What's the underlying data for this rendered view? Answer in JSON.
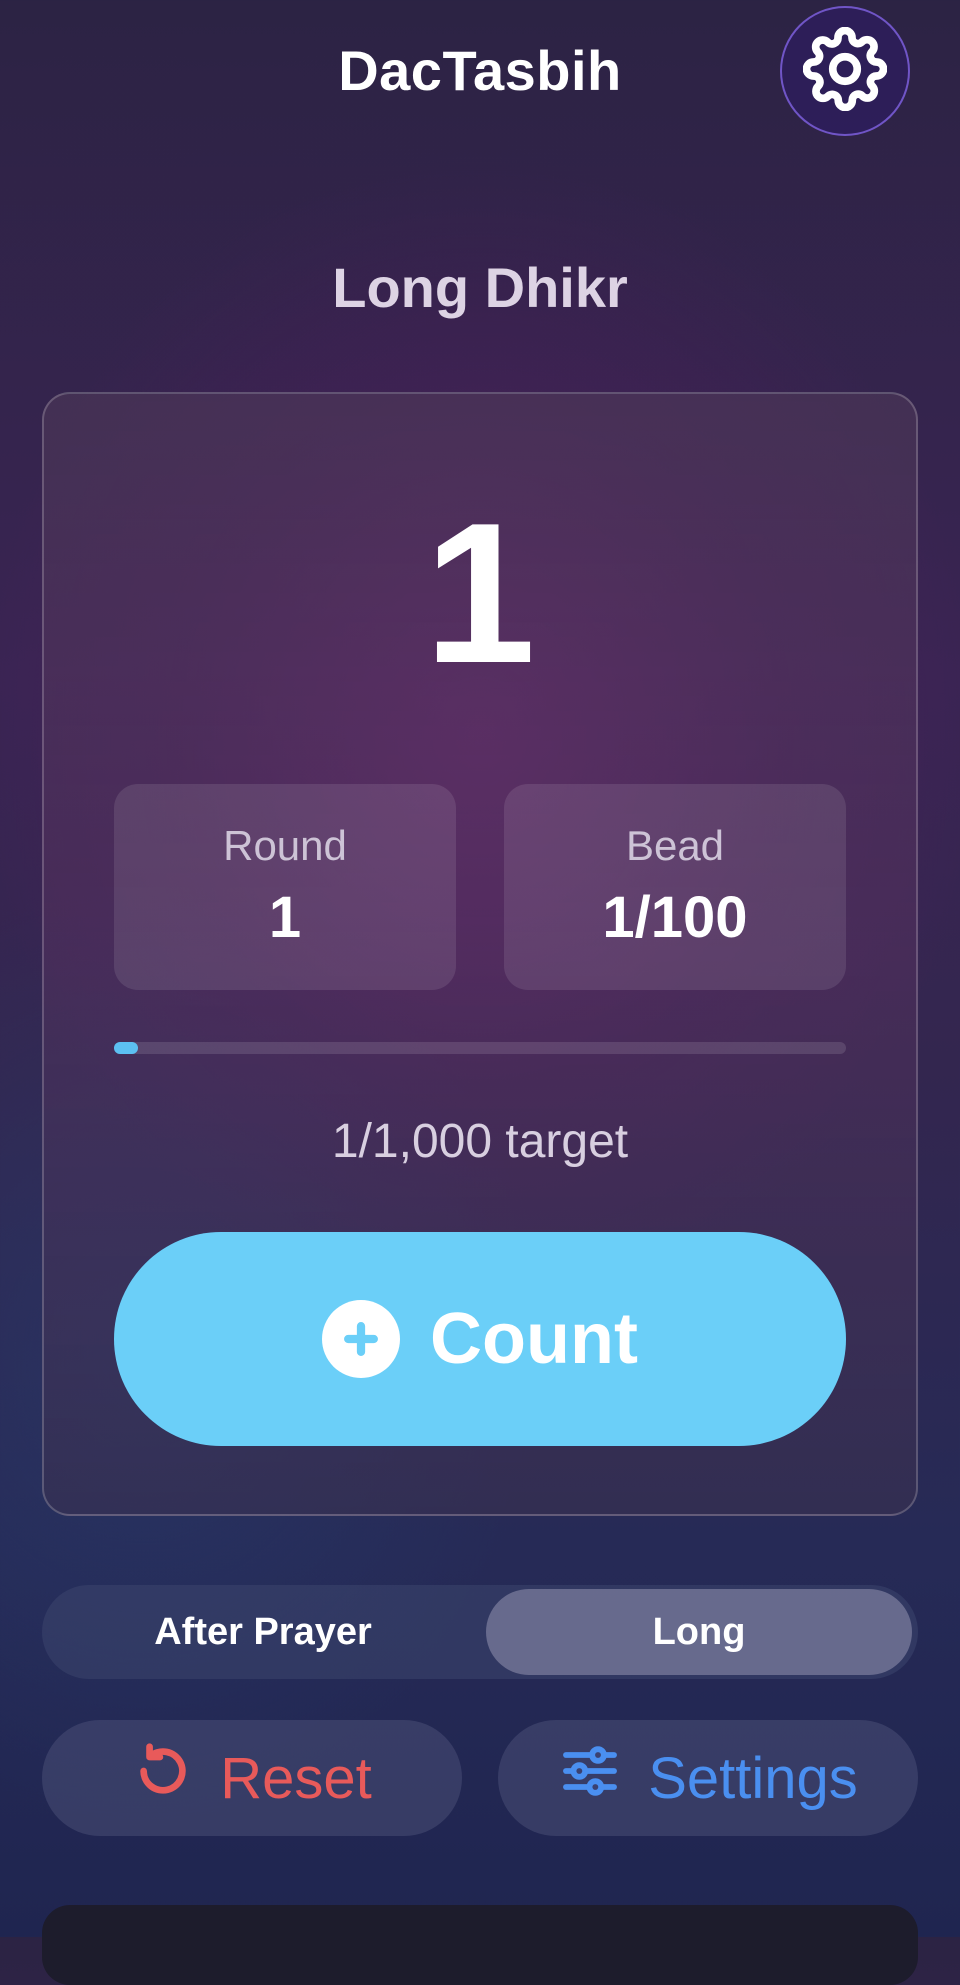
{
  "header": {
    "app_title": "DacTasbih",
    "settings_icon": "gear-icon"
  },
  "dhikr": {
    "title": "Long Dhikr",
    "count": "1",
    "round_label": "Round",
    "round_value": "1",
    "bead_label": "Bead",
    "bead_value": "1/100",
    "progress_fraction": 0.001,
    "target_text": "1/1,000 target",
    "count_button_label": "Count",
    "count_button_icon": "plus-circle-icon"
  },
  "mode_selector": {
    "options": [
      "After Prayer",
      "Long"
    ],
    "selected": "Long"
  },
  "actions": {
    "reset_label": "Reset",
    "reset_icon": "reset-icon",
    "settings_label": "Settings",
    "settings_icon": "sliders-icon"
  },
  "colors": {
    "accent": "#6bcff8",
    "reset": "#e85a5a",
    "settings": "#4a8ff0"
  }
}
